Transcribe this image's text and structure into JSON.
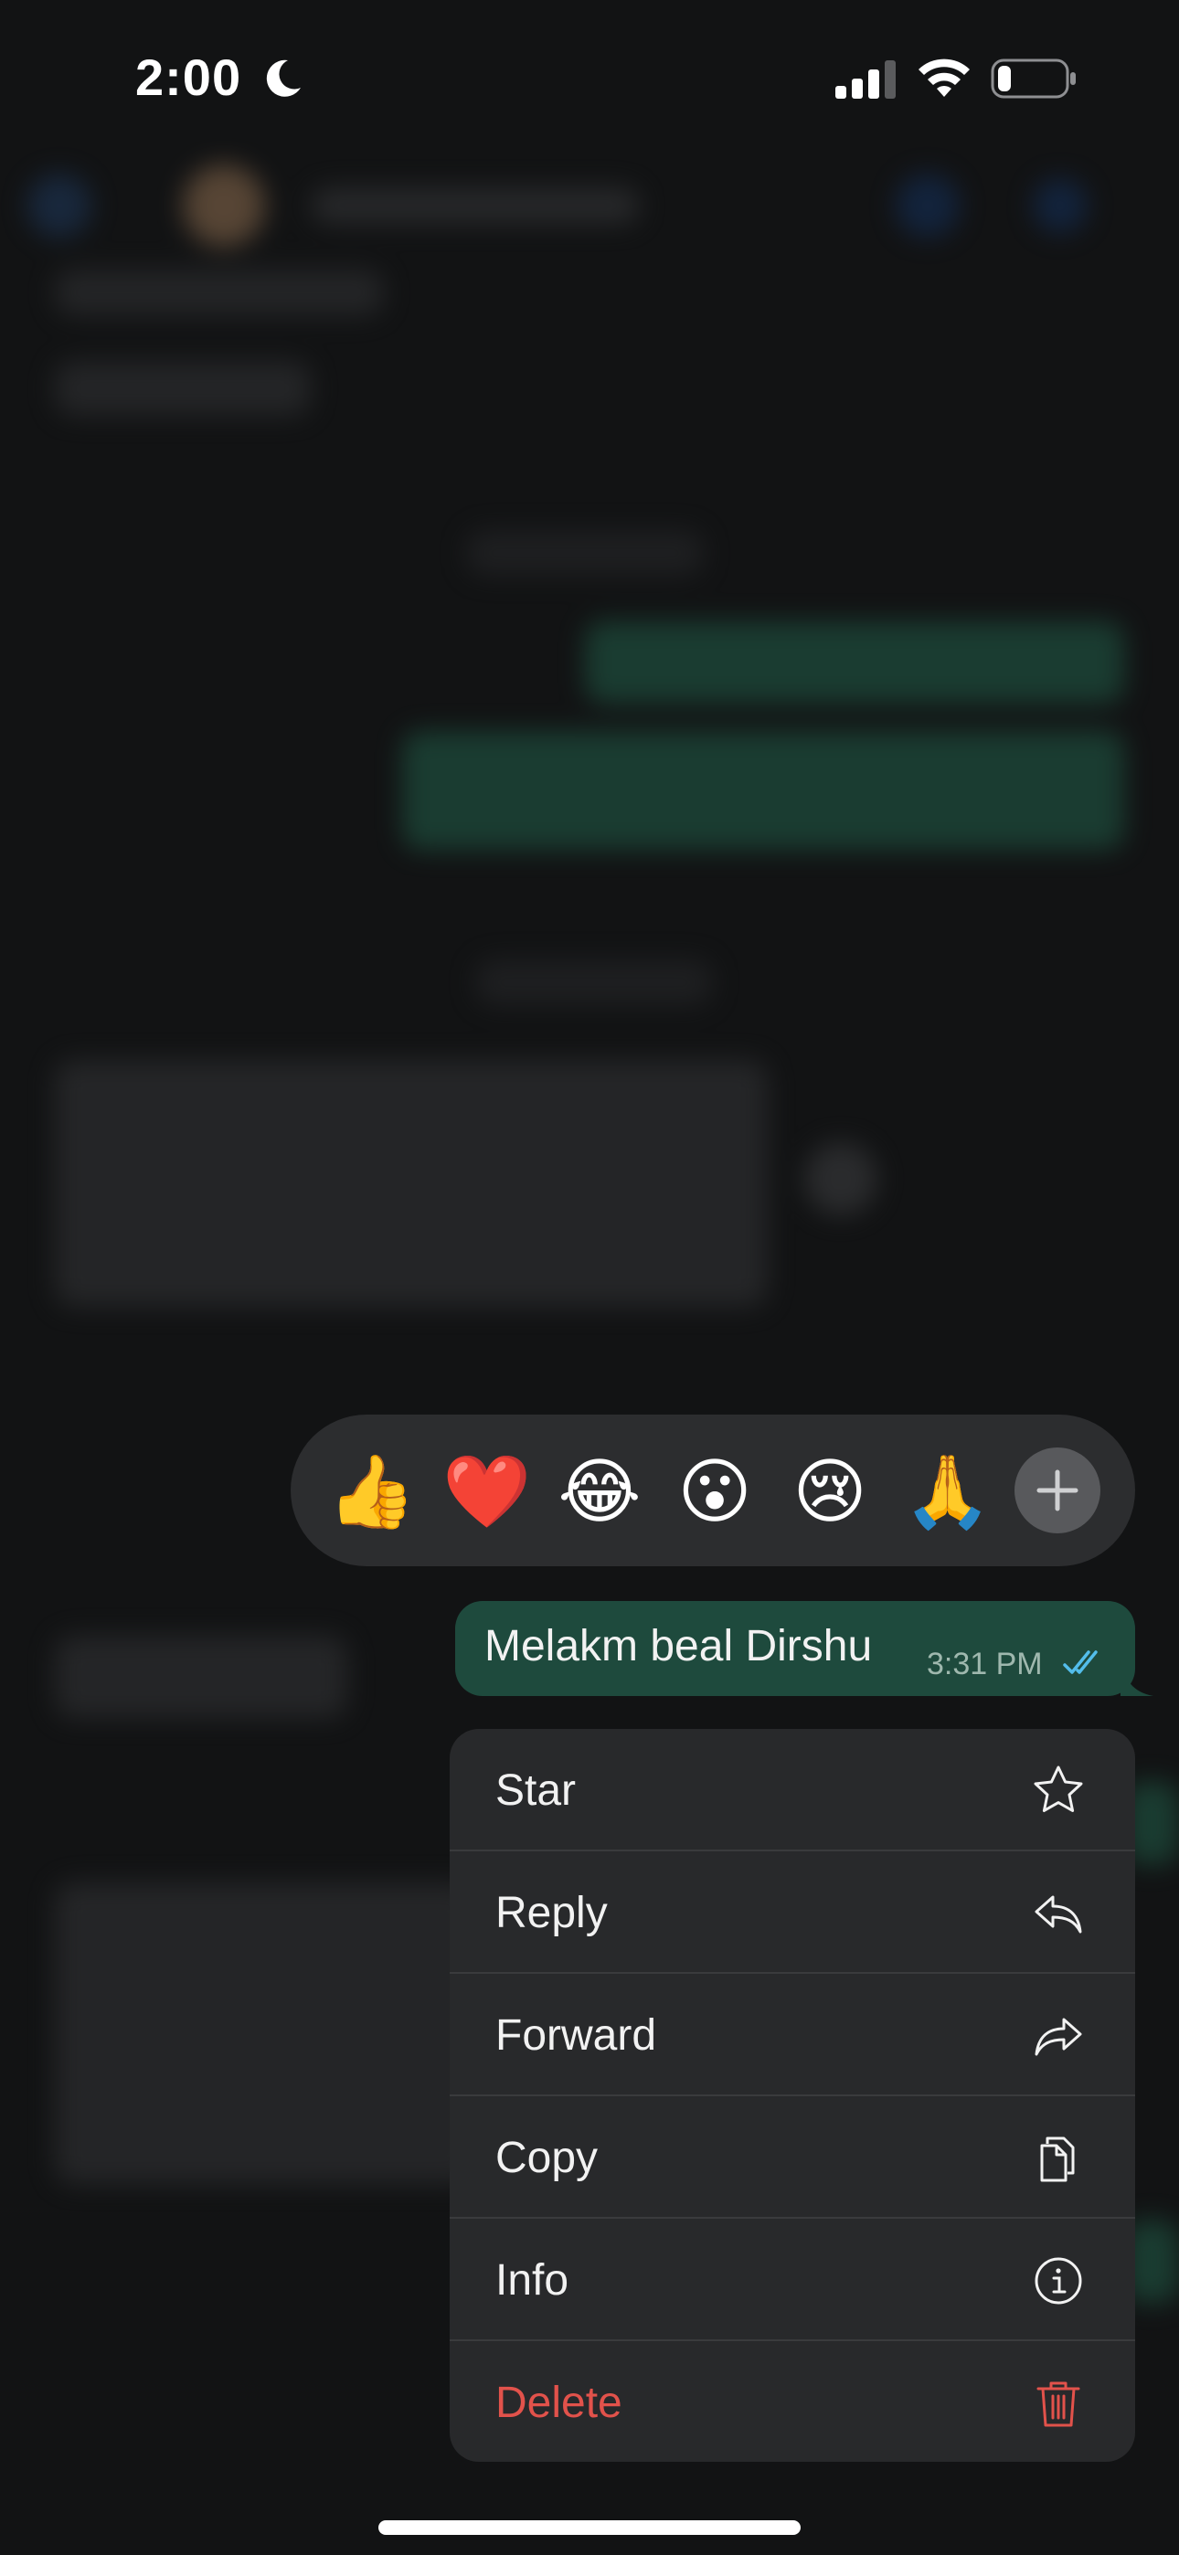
{
  "status_bar": {
    "time": "2:00",
    "icons": [
      "moon-icon",
      "cellular-signal-icon",
      "wifi-icon",
      "battery-icon"
    ],
    "battery_level": 0.2
  },
  "reactions": {
    "emojis": [
      {
        "name": "thumbs-up-emoji",
        "glyph": "👍"
      },
      {
        "name": "red-heart-emoji",
        "glyph": "❤️"
      },
      {
        "name": "tears-of-joy-emoji",
        "glyph": "😂"
      },
      {
        "name": "surprised-emoji",
        "glyph": "😮"
      },
      {
        "name": "crying-emoji",
        "glyph": "😢"
      },
      {
        "name": "folded-hands-emoji",
        "glyph": "🙏"
      }
    ],
    "more_icon": "plus-icon"
  },
  "message": {
    "text": "Melakm beal Dirshu",
    "time": "3:31 PM",
    "status_icon": "double-check-read-icon"
  },
  "context_menu": {
    "items": [
      {
        "label": "Star",
        "icon": "star-icon"
      },
      {
        "label": "Reply",
        "icon": "reply-icon"
      },
      {
        "label": "Forward",
        "icon": "forward-icon"
      },
      {
        "label": "Copy",
        "icon": "copy-icon"
      },
      {
        "label": "Info",
        "icon": "info-icon"
      },
      {
        "label": "Delete",
        "icon": "trash-icon",
        "destructive": true
      }
    ]
  },
  "colors": {
    "outgoing_bubble": "#1e4a3d",
    "menu_background": "#28292b",
    "destructive": "#e2524b",
    "read_tick": "#53bdeb"
  }
}
